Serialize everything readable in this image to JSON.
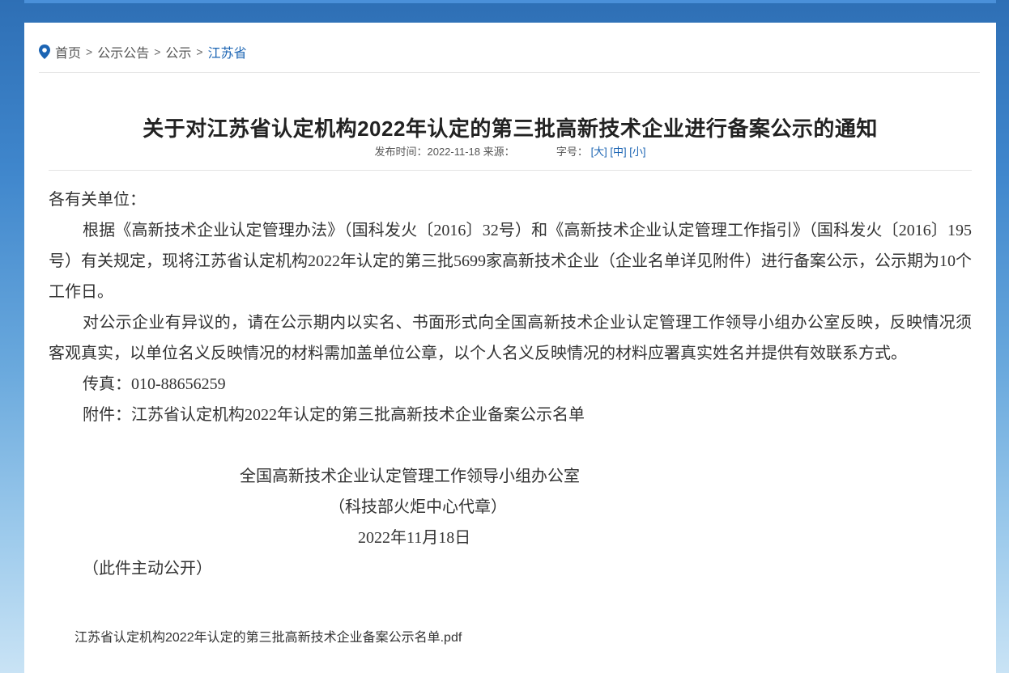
{
  "breadcrumb": {
    "items": [
      "首页",
      "公示公告",
      "公示"
    ],
    "current": "江苏省",
    "separator": ">"
  },
  "article": {
    "title": "关于对江苏省认定机构2022年认定的第三批高新技术企业进行备案公示的通知",
    "meta": {
      "publish_label": "发布时间：",
      "publish_date": "2022-11-18",
      "source_label": "来源：",
      "fontsize_label": "字号：",
      "size_large": "[大]",
      "size_medium": "[中]",
      "size_small": "[小]"
    },
    "salutation": "各有关单位：",
    "para1": "根据《高新技术企业认定管理办法》（国科发火〔2016〕32号）和《高新技术企业认定管理工作指引》（国科发火〔2016〕195号）有关规定，现将江苏省认定机构2022年认定的第三批5699家高新技术企业（企业名单详见附件）进行备案公示，公示期为10个工作日。",
    "para2": "对公示企业有异议的，请在公示期内以实名、书面形式向全国高新技术企业认定管理工作领导小组办公室反映，反映情况须客观真实，以单位名义反映情况的材料需加盖单位公章，以个人名义反映情况的材料应署真实姓名并提供有效联系方式。",
    "fax": "传真：010-88656259",
    "attachment_note": "附件：江苏省认定机构2022年认定的第三批高新技术企业备案公示名单",
    "signature_org": "全国高新技术企业认定管理工作领导小组办公室",
    "signature_proxy": "（科技部火炬中心代章）",
    "signature_date": "2022年11月18日",
    "disclosure": "（此件主动公开）",
    "attachment_link": "江苏省认定机构2022年认定的第三批高新技术企业备案公示名单.pdf"
  },
  "colors": {
    "accent": "#1b64b3",
    "page_bg_top": "#2e6fb5",
    "page_bg_bottom": "#c9e3f5"
  },
  "icons": {
    "breadcrumb": "location-pin-icon"
  }
}
